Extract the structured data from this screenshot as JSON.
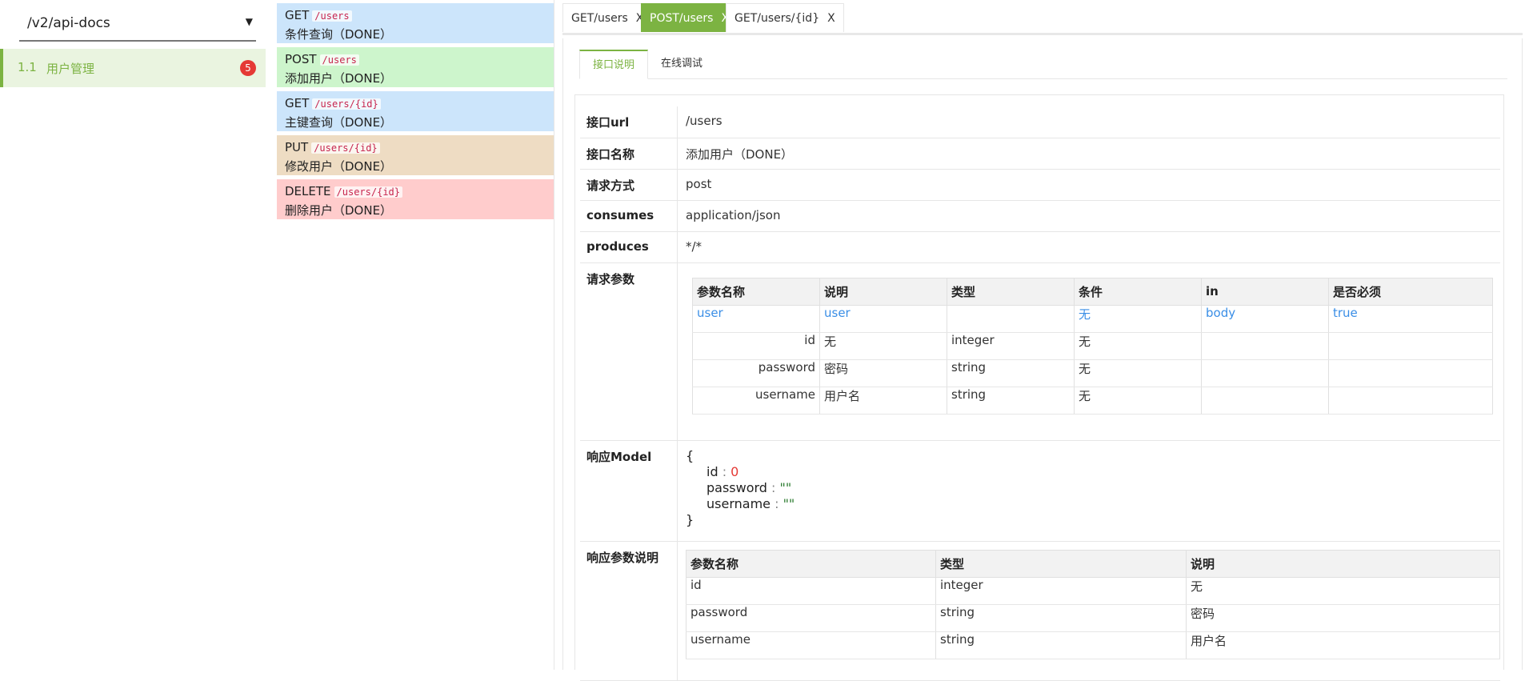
{
  "sidebar": {
    "version": "/v2/api-docs",
    "group": {
      "num": "1.1",
      "label": "用户管理",
      "badge": "5"
    }
  },
  "api_list": [
    {
      "method": "GET",
      "path": "/users",
      "desc": "条件查询（DONE）",
      "color": "#cce5fb"
    },
    {
      "method": "POST",
      "path": "/users",
      "desc": "添加用户（DONE）",
      "color": "#cdf5cc"
    },
    {
      "method": "GET",
      "path": "/users/{id}",
      "desc": "主键查询（DONE）",
      "color": "#cce5fb"
    },
    {
      "method": "PUT",
      "path": "/users/{id}",
      "desc": "修改用户（DONE）",
      "color": "#eedcc3"
    },
    {
      "method": "DELETE",
      "path": "/users/{id}",
      "desc": "删除用户（DONE）",
      "color": "#ffcccc"
    }
  ],
  "tabs": [
    {
      "label": "GET/users",
      "close": "X"
    },
    {
      "label": "POST/users",
      "close": "X"
    },
    {
      "label": "GET/users/{id}",
      "close": "X"
    }
  ],
  "inner_tabs": [
    "接口说明",
    "在线调试"
  ],
  "detail": {
    "url": {
      "key": "接口url",
      "value": "/users"
    },
    "name": {
      "key": "接口名称",
      "value": "添加用户（DONE）"
    },
    "method": {
      "key": "请求方式",
      "value": "post"
    },
    "consumes": {
      "key": "consumes",
      "value": "application/json"
    },
    "produces": {
      "key": "produces",
      "value": "*/*"
    },
    "params": {
      "key": "请求参数",
      "headers": [
        "参数名称",
        "说明",
        "类型",
        "条件",
        "in",
        "是否必须"
      ],
      "rows": [
        [
          "user",
          "user",
          "",
          "无",
          "body",
          "true"
        ],
        [
          "id",
          "无",
          "integer",
          "无",
          "",
          ""
        ],
        [
          "password",
          "密码",
          "string",
          "无",
          "",
          ""
        ],
        [
          "username",
          "用户名",
          "string",
          "无",
          "",
          ""
        ]
      ]
    },
    "model": {
      "key": "响应Model",
      "open": "{",
      "close": "}",
      "fields": [
        {
          "name": "id",
          "colon": " : ",
          "value": "0"
        },
        {
          "name": "password",
          "colon": " : ",
          "value": "\"\""
        },
        {
          "name": "username",
          "colon": " : ",
          "value": "\"\""
        }
      ]
    },
    "resp_params": {
      "key": "响应参数说明",
      "headers": [
        "参数名称",
        "类型",
        "说明"
      ],
      "rows": [
        [
          "id",
          "integer",
          "无"
        ],
        [
          "password",
          "string",
          "密码"
        ],
        [
          "username",
          "string",
          "用户名"
        ]
      ]
    }
  },
  "colors": {
    "accent": "#7cb342",
    "badge": "#e53935",
    "link": "#3a8ee6"
  }
}
